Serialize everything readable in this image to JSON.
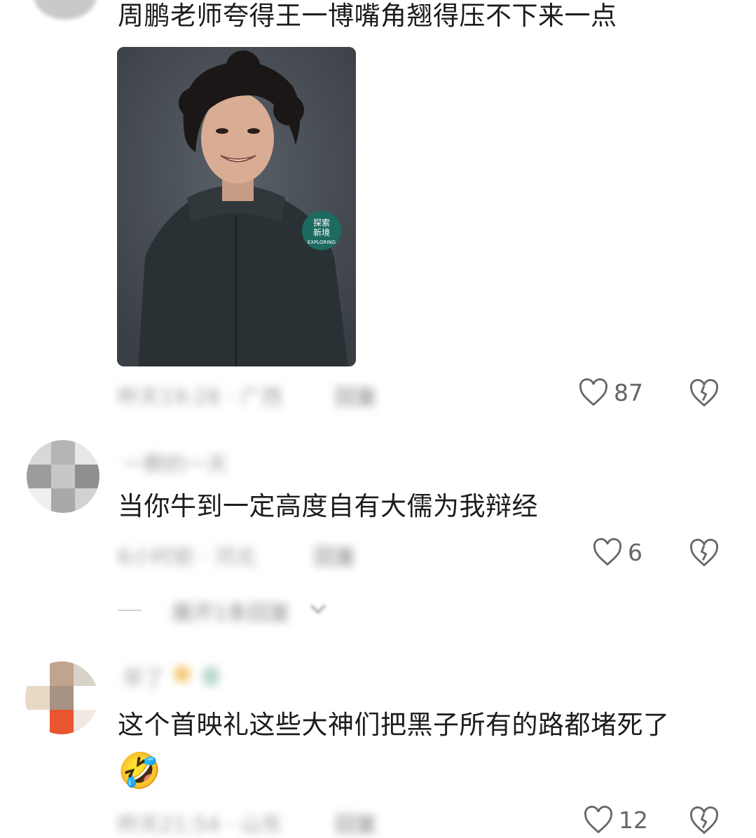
{
  "comments": [
    {
      "text": "周鹏老师夸得王一博嘴角翘得压不下来一点",
      "meta": "昨天19:28 · 广西",
      "reply_label": "回复",
      "likes": "87",
      "image": {
        "badge_line1": "探索",
        "badge_line2": "新境",
        "badge_line3": "EXPLORING"
      }
    },
    {
      "username": "一颗的一天",
      "text": "当你牛到一定高度自有大儒为我辩经",
      "meta": "6小时前 · 河北",
      "reply_label": "回复",
      "likes": "6",
      "expand_replies": "展开1条回复"
    },
    {
      "username": "早了",
      "text": "这个首映礼这些大神们把黑子所有的路都堵死了",
      "emoji": "🤣",
      "meta": "昨天21:54 · 山东",
      "reply_label": "回复",
      "likes": "12"
    }
  ]
}
